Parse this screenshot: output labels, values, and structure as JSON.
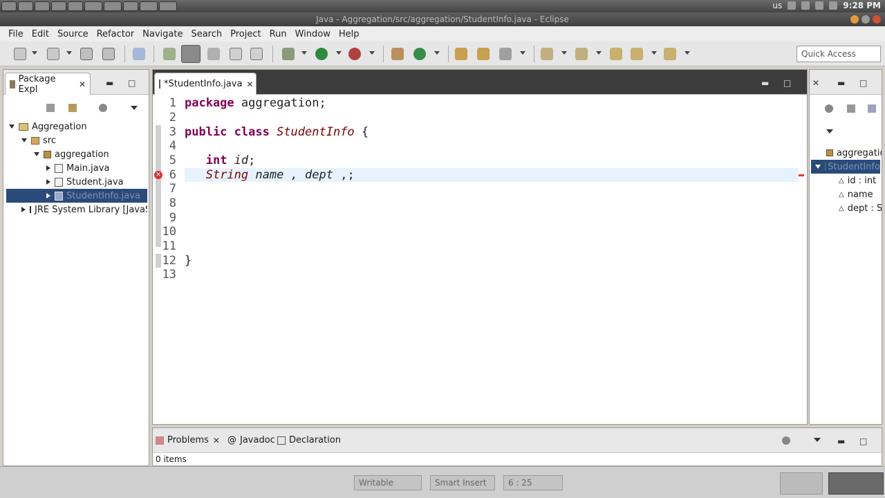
{
  "os_panel": {
    "layout": "us",
    "time": "9:28 PM"
  },
  "window": {
    "title": "Java - Aggregation/src/aggregation/StudentInfo.java - Eclipse"
  },
  "menubar": [
    "File",
    "Edit",
    "Source",
    "Refactor",
    "Navigate",
    "Search",
    "Project",
    "Run",
    "Window",
    "Help"
  ],
  "toolbar": {
    "quick_access": "Quick Access"
  },
  "package_explorer": {
    "tab_label": "Package Expl",
    "tree": {
      "project": "Aggregation",
      "src": "src",
      "package": "aggregation",
      "files": [
        "Main.java",
        "Student.java",
        "StudentInfo.java"
      ],
      "library": "JRE System Library [JavaSE"
    }
  },
  "editor": {
    "tab_label": "*StudentInfo.java",
    "lines": [
      {
        "n": "1"
      },
      {
        "n": "2"
      },
      {
        "n": "3"
      },
      {
        "n": "4"
      },
      {
        "n": "5"
      },
      {
        "n": "6"
      },
      {
        "n": "7"
      },
      {
        "n": "8"
      },
      {
        "n": "9"
      },
      {
        "n": "10"
      },
      {
        "n": "11"
      },
      {
        "n": "12"
      },
      {
        "n": "13"
      }
    ],
    "code": {
      "l1_kw": "package",
      "l1_rest": " aggregation;",
      "l3_kw1": "public",
      "l3_kw2": " class",
      "l3_cls": " StudentInfo",
      "l3_rest": " {",
      "l5_kw": "int",
      "l5_var": " id",
      "l5_rest": ";",
      "l6_type": "String",
      "l6_v1": " name",
      "l6_sep": " ,",
      "l6_v2": " dept",
      "l6_rest": " ,;",
      "l12": "}"
    }
  },
  "outline": {
    "package": "aggregatio",
    "class": "StudentInfo",
    "fields": [
      "id : int",
      "name",
      "dept : S"
    ]
  },
  "problems": {
    "tabs": [
      "Problems",
      "Javadoc",
      "Declaration"
    ],
    "count": "0 items"
  },
  "statusbar": {
    "writable": "Writable",
    "insert_mode": "Smart Insert",
    "position": "6 : 25"
  }
}
